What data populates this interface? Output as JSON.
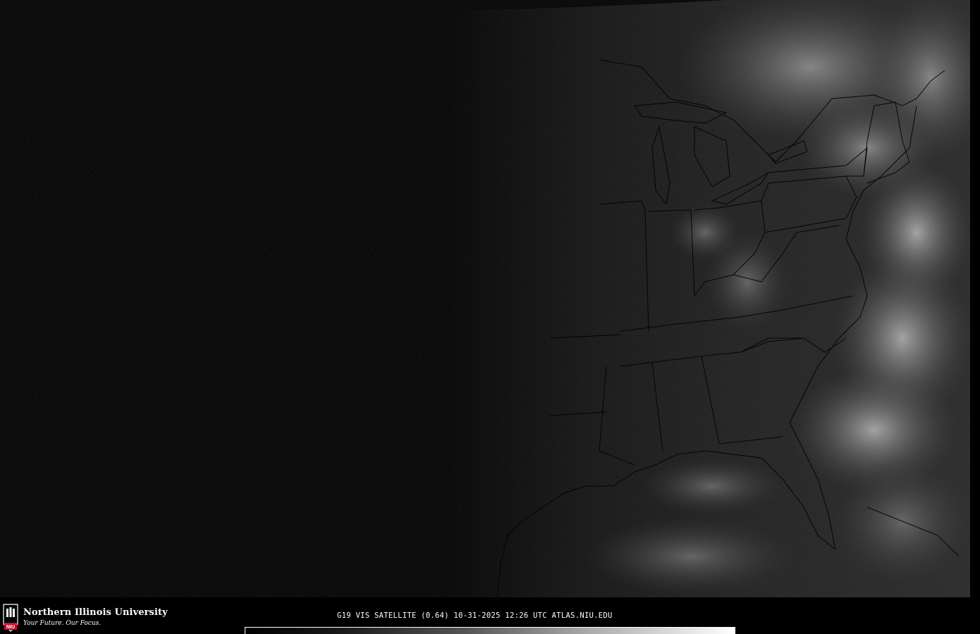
{
  "map": {
    "product": "visible satellite imagery",
    "region": "eastern United States"
  },
  "footer": {
    "logo_name": "Northern Illinois University",
    "logo_tagline": "Your Future. Our Focus.",
    "logo_shield_letters": "NIU",
    "caption": "G19 VIS SATELLITE (0.64) 10-31-2025 12:26 UTC  ATLAS.NIU.EDU"
  },
  "colors": {
    "background": "#000000",
    "land_night": "#000000",
    "land_day": "#1f1f1f",
    "cloud": "#d8d8d8",
    "boundary": "#000000",
    "niu_red": "#c8102e"
  }
}
